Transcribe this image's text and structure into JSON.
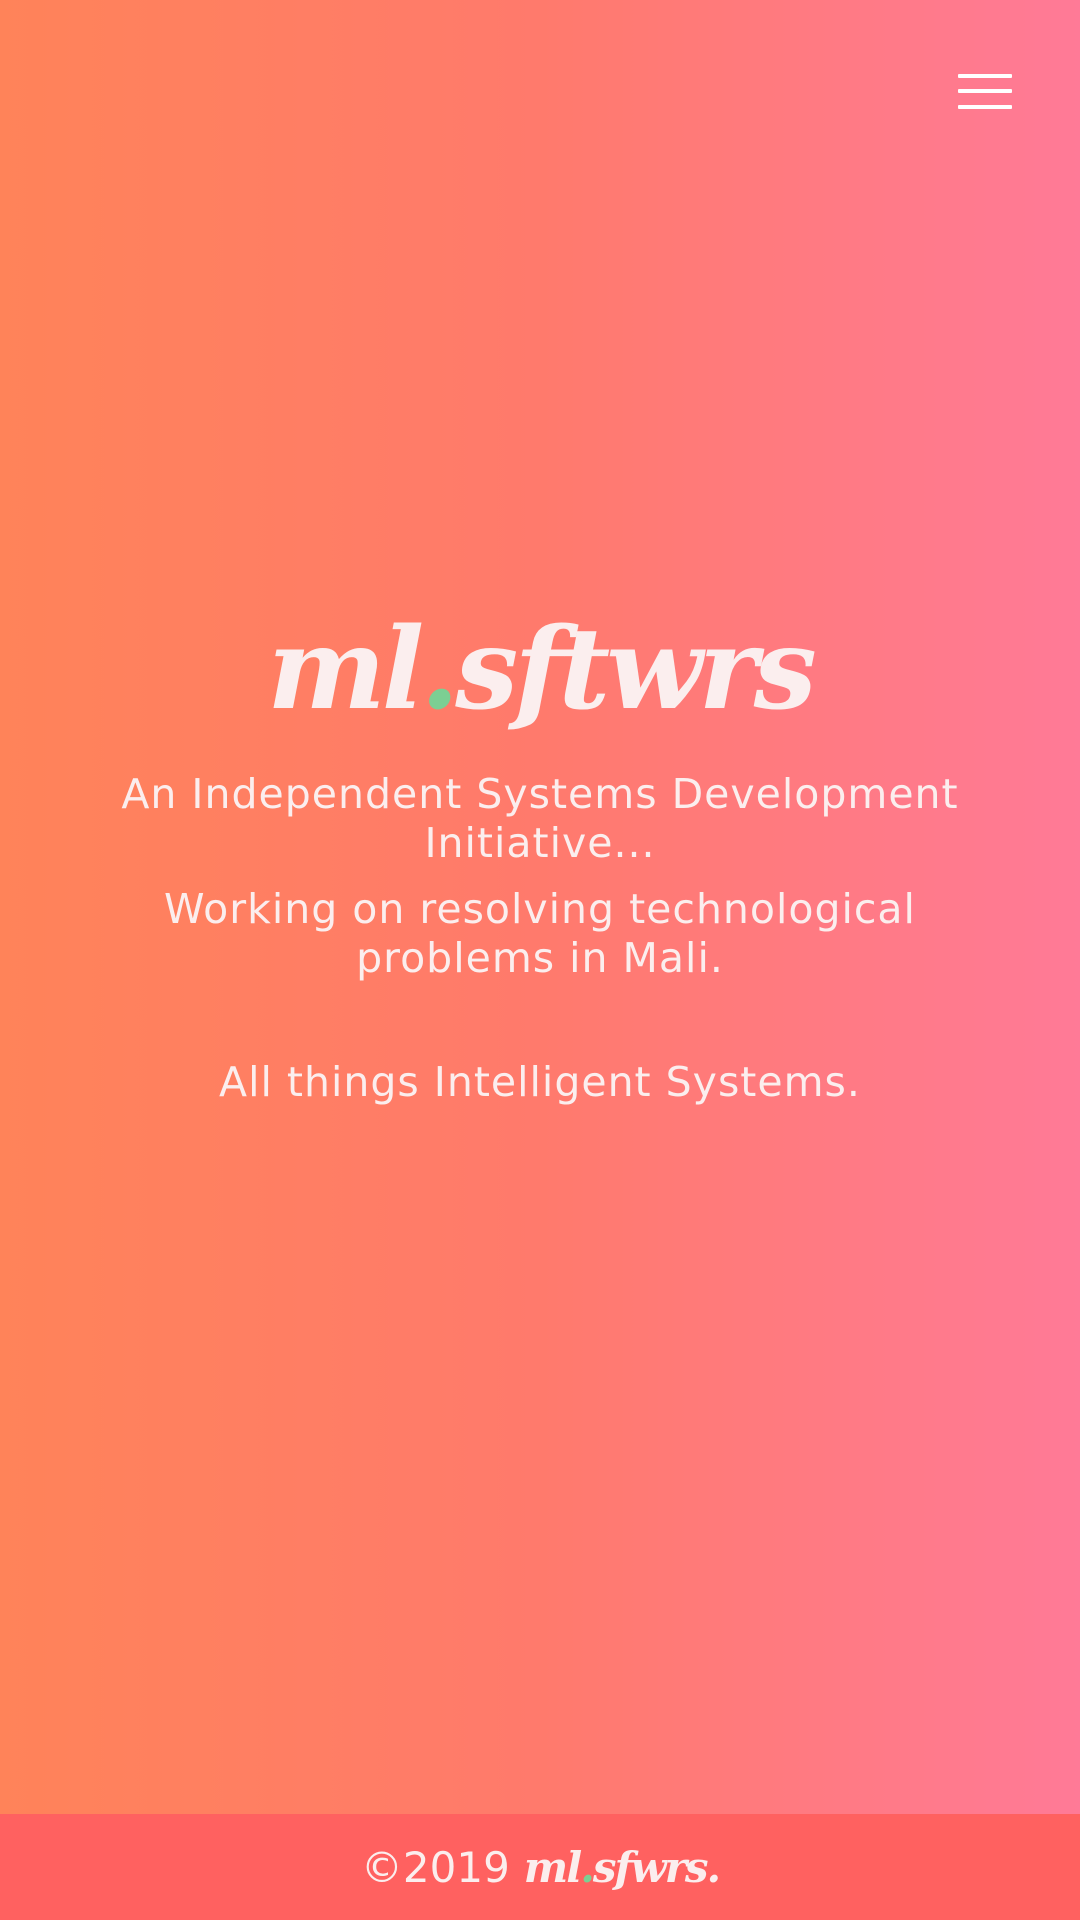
{
  "nav": {
    "menu_icon": "hamburger-menu-icon"
  },
  "hero": {
    "logo_part1": "ml",
    "logo_dot": ".",
    "logo_part2": "sftwrs",
    "tagline_1": "An Independent Systems Development Initiative...",
    "tagline_2": "Working on resolving technological problems in Mali.",
    "tagline_3": "All things Intelligent Systems."
  },
  "footer": {
    "copyright": "©2019",
    "brand_part1": "ml",
    "brand_dot": ".",
    "brand_part2": "sfwrs."
  },
  "colors": {
    "gradient_start": "#ff8359",
    "gradient_end": "#ff7a97",
    "footer_bg": "#ff6160",
    "logo_dot": "#7ccf93",
    "text": "#fbeeee"
  }
}
